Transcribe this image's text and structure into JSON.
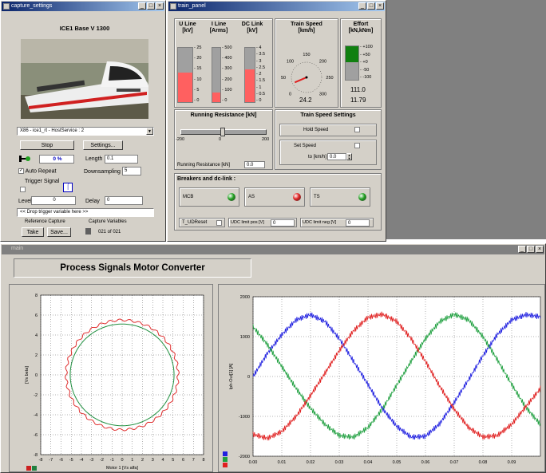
{
  "capture_window": {
    "title": "capture_settings",
    "model_title": "ICE1 Base V 1300",
    "platform_select": "X86 - ice1_rt - HostService : 2",
    "stop_label": "Stop",
    "settings_label": "Settings...",
    "progress": "0 %",
    "length_label": "Length",
    "length_value": "0.1",
    "auto_repeat_label": "Auto Repeat",
    "downsampling_label": "Downsampling",
    "downsampling_value": "5",
    "trigger_signal_label": "Trigger Signal",
    "level_label": "Level",
    "level_value": "0",
    "delay_label": "Delay",
    "delay_value": "0",
    "drop_trigger": "<< Drop trigger variable here >>",
    "reference_capture_label": "Reference Capture",
    "take_label": "Take",
    "save_label": "Save...",
    "capture_variables_label": "Capture Variables",
    "capture_count": "021 of 021"
  },
  "train_panel": {
    "title": "train_panel",
    "u_line": {
      "label_line1": "U Line",
      "label_line2": "[kV]",
      "ticks": [
        "25",
        "20",
        "15",
        "10",
        "5",
        "0"
      ],
      "fraction": 0.55
    },
    "i_line": {
      "label_line1": "I Line",
      "label_line2": "[Arms]",
      "ticks": [
        "500",
        "400",
        "300",
        "200",
        "100",
        "0"
      ],
      "fraction": 0.18
    },
    "dc_link": {
      "label_line1": "DC Link",
      "label_line2": "[kV]",
      "ticks": [
        "4",
        "3.5",
        "3",
        "2.5",
        "2",
        "1.5",
        "1",
        "0.5",
        "0"
      ],
      "fraction": 0.6
    },
    "speed": {
      "label_line1": "Train Speed",
      "label_line2": "[km/h]",
      "ticks": [
        "0",
        "50",
        "100",
        "150",
        "200",
        "250",
        "300"
      ],
      "value": "24.2",
      "speed_kmh": 24.2
    },
    "effort": {
      "label_line1": "Effort",
      "label_line2": "[kN,kNm]",
      "ticks": [
        "+100",
        "+50",
        "+0",
        "-50",
        "-100"
      ],
      "value1": "111.0",
      "value2": "11.79",
      "fraction": 0.48
    },
    "running_resistance": {
      "title": "Running Resistance [kN]",
      "ticks": [
        "-200",
        "0",
        "200"
      ],
      "field_label": "Running Resistance [kN]",
      "field_value": "0.0"
    },
    "speed_settings": {
      "title": "Train Speed Settings",
      "hold_speed_label": "Hold Speed",
      "set_speed_label": "Set Speed",
      "to_label": "to [km/h]",
      "to_value": "0.0"
    },
    "breakers": {
      "title": "Breakers and dc-link :",
      "items": [
        {
          "label": "MCB",
          "color": "#20a020"
        },
        {
          "label": "AS",
          "color": "#e02020"
        },
        {
          "label": "TS",
          "color": "#20a020"
        }
      ],
      "reset_label": "T_UDReset",
      "udc_pos_label": "UDC limit pos [V]",
      "udc_pos_value": "0",
      "udc_neg_label": "UDC limit neg [V]",
      "udc_neg_value": "0"
    }
  },
  "signals_window": {
    "title": "main",
    "heading": "Process Signals Motor Converter",
    "left_plot": {
      "xlabel": "Motor 1 [Vs alfa]",
      "ylabel": "[Vs beta]",
      "xticks": [
        "-8",
        "-7",
        "-6",
        "-5",
        "-4",
        "-3",
        "-2",
        "-1",
        "0",
        "1",
        "2",
        "3",
        "4",
        "5",
        "6",
        "7",
        "8"
      ],
      "yticks": [
        "8",
        "6",
        "4",
        "2",
        "0",
        "-2",
        "-4",
        "-6",
        "-8"
      ],
      "legend_colors": [
        "#cc2020",
        "#208040"
      ]
    },
    "right_plot": {
      "ylabel": "Iph-Out[1] [A]",
      "xticks": [
        "0.00",
        "0.01",
        "0.02",
        "0.03",
        "0.04",
        "0.05",
        "0.06",
        "0.07",
        "0.08",
        "0.09"
      ],
      "yticks": [
        "2000",
        "1000",
        "0",
        "-1000",
        "-2000"
      ],
      "legend_colors": [
        "#2020e0",
        "#20a040",
        "#e02020"
      ]
    }
  },
  "chart_data": [
    {
      "type": "scatter",
      "title": "",
      "xlabel": "Motor 1 [Vs alfa]",
      "ylabel": "[Vs beta]",
      "xlim": [
        -8,
        8
      ],
      "ylim": [
        -8,
        8
      ],
      "grid": true,
      "series": [
        {
          "color": "#e03030",
          "shape": "circle",
          "radius": 5.5
        },
        {
          "color": "#209040",
          "shape": "circle",
          "radius": 5.1
        }
      ]
    },
    {
      "type": "line",
      "title": "",
      "xlabel": "",
      "ylabel": "Iph-Out[1] [A]",
      "xlim": [
        0,
        0.1
      ],
      "ylim": [
        -2000,
        2000
      ],
      "grid": true,
      "series": [
        {
          "color": "#2020e0",
          "x": [
            0,
            0.005,
            0.01,
            0.015,
            0.02,
            0.025,
            0.03,
            0.035,
            0.04,
            0.045,
            0.05,
            0.055,
            0.06,
            0.065,
            0.07,
            0.075,
            0.08,
            0.085,
            0.09,
            0.095,
            0.1
          ],
          "values": [
            0,
            580,
            1050,
            1420,
            1550,
            1380,
            950,
            380,
            -200,
            -800,
            -1250,
            -1520,
            -1500,
            -1180,
            -650,
            -80,
            520,
            1050,
            1420,
            1550,
            1500
          ]
        },
        {
          "color": "#20a040",
          "x": [
            0,
            0.005,
            0.01,
            0.015,
            0.02,
            0.025,
            0.03,
            0.035,
            0.04,
            0.045,
            0.05,
            0.055,
            0.06,
            0.065,
            0.07,
            0.075,
            0.08,
            0.085,
            0.09,
            0.095,
            0.1
          ],
          "values": [
            1250,
            800,
            250,
            -300,
            -800,
            -1200,
            -1480,
            -1520,
            -1280,
            -820,
            -220,
            380,
            950,
            1380,
            1560,
            1420,
            1000,
            420,
            -200,
            -780,
            -1200
          ]
        },
        {
          "color": "#e02020",
          "x": [
            0,
            0.005,
            0.01,
            0.015,
            0.02,
            0.025,
            0.03,
            0.035,
            0.04,
            0.045,
            0.05,
            0.055,
            0.06,
            0.065,
            0.07,
            0.075,
            0.08,
            0.085,
            0.09,
            0.095,
            0.1
          ],
          "values": [
            -1450,
            -1550,
            -1380,
            -1000,
            -480,
            80,
            650,
            1150,
            1480,
            1560,
            1380,
            950,
            380,
            -250,
            -820,
            -1280,
            -1520,
            -1480,
            -1200,
            -750,
            -300
          ]
        }
      ]
    }
  ]
}
